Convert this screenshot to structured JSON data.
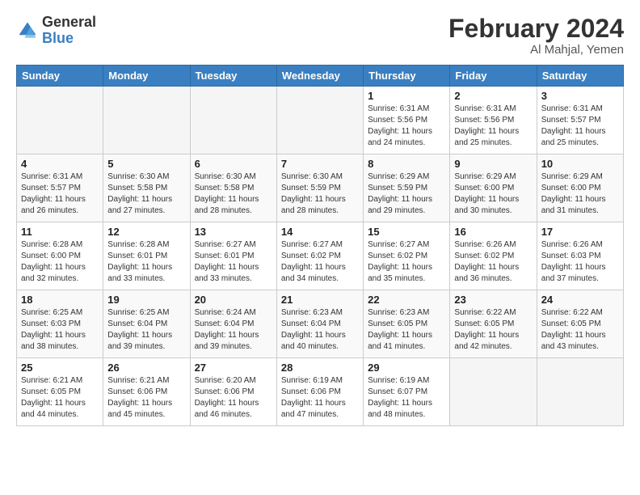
{
  "header": {
    "logo_general": "General",
    "logo_blue": "Blue",
    "month_title": "February 2024",
    "location": "Al Mahjal, Yemen"
  },
  "weekdays": [
    "Sunday",
    "Monday",
    "Tuesday",
    "Wednesday",
    "Thursday",
    "Friday",
    "Saturday"
  ],
  "weeks": [
    [
      {
        "day": "",
        "sunrise": "",
        "sunset": "",
        "daylight": ""
      },
      {
        "day": "",
        "sunrise": "",
        "sunset": "",
        "daylight": ""
      },
      {
        "day": "",
        "sunrise": "",
        "sunset": "",
        "daylight": ""
      },
      {
        "day": "",
        "sunrise": "",
        "sunset": "",
        "daylight": ""
      },
      {
        "day": "1",
        "sunrise": "Sunrise: 6:31 AM",
        "sunset": "Sunset: 5:56 PM",
        "daylight": "Daylight: 11 hours and 24 minutes."
      },
      {
        "day": "2",
        "sunrise": "Sunrise: 6:31 AM",
        "sunset": "Sunset: 5:56 PM",
        "daylight": "Daylight: 11 hours and 25 minutes."
      },
      {
        "day": "3",
        "sunrise": "Sunrise: 6:31 AM",
        "sunset": "Sunset: 5:57 PM",
        "daylight": "Daylight: 11 hours and 25 minutes."
      }
    ],
    [
      {
        "day": "4",
        "sunrise": "Sunrise: 6:31 AM",
        "sunset": "Sunset: 5:57 PM",
        "daylight": "Daylight: 11 hours and 26 minutes."
      },
      {
        "day": "5",
        "sunrise": "Sunrise: 6:30 AM",
        "sunset": "Sunset: 5:58 PM",
        "daylight": "Daylight: 11 hours and 27 minutes."
      },
      {
        "day": "6",
        "sunrise": "Sunrise: 6:30 AM",
        "sunset": "Sunset: 5:58 PM",
        "daylight": "Daylight: 11 hours and 28 minutes."
      },
      {
        "day": "7",
        "sunrise": "Sunrise: 6:30 AM",
        "sunset": "Sunset: 5:59 PM",
        "daylight": "Daylight: 11 hours and 28 minutes."
      },
      {
        "day": "8",
        "sunrise": "Sunrise: 6:29 AM",
        "sunset": "Sunset: 5:59 PM",
        "daylight": "Daylight: 11 hours and 29 minutes."
      },
      {
        "day": "9",
        "sunrise": "Sunrise: 6:29 AM",
        "sunset": "Sunset: 6:00 PM",
        "daylight": "Daylight: 11 hours and 30 minutes."
      },
      {
        "day": "10",
        "sunrise": "Sunrise: 6:29 AM",
        "sunset": "Sunset: 6:00 PM",
        "daylight": "Daylight: 11 hours and 31 minutes."
      }
    ],
    [
      {
        "day": "11",
        "sunrise": "Sunrise: 6:28 AM",
        "sunset": "Sunset: 6:00 PM",
        "daylight": "Daylight: 11 hours and 32 minutes."
      },
      {
        "day": "12",
        "sunrise": "Sunrise: 6:28 AM",
        "sunset": "Sunset: 6:01 PM",
        "daylight": "Daylight: 11 hours and 33 minutes."
      },
      {
        "day": "13",
        "sunrise": "Sunrise: 6:27 AM",
        "sunset": "Sunset: 6:01 PM",
        "daylight": "Daylight: 11 hours and 33 minutes."
      },
      {
        "day": "14",
        "sunrise": "Sunrise: 6:27 AM",
        "sunset": "Sunset: 6:02 PM",
        "daylight": "Daylight: 11 hours and 34 minutes."
      },
      {
        "day": "15",
        "sunrise": "Sunrise: 6:27 AM",
        "sunset": "Sunset: 6:02 PM",
        "daylight": "Daylight: 11 hours and 35 minutes."
      },
      {
        "day": "16",
        "sunrise": "Sunrise: 6:26 AM",
        "sunset": "Sunset: 6:02 PM",
        "daylight": "Daylight: 11 hours and 36 minutes."
      },
      {
        "day": "17",
        "sunrise": "Sunrise: 6:26 AM",
        "sunset": "Sunset: 6:03 PM",
        "daylight": "Daylight: 11 hours and 37 minutes."
      }
    ],
    [
      {
        "day": "18",
        "sunrise": "Sunrise: 6:25 AM",
        "sunset": "Sunset: 6:03 PM",
        "daylight": "Daylight: 11 hours and 38 minutes."
      },
      {
        "day": "19",
        "sunrise": "Sunrise: 6:25 AM",
        "sunset": "Sunset: 6:04 PM",
        "daylight": "Daylight: 11 hours and 39 minutes."
      },
      {
        "day": "20",
        "sunrise": "Sunrise: 6:24 AM",
        "sunset": "Sunset: 6:04 PM",
        "daylight": "Daylight: 11 hours and 39 minutes."
      },
      {
        "day": "21",
        "sunrise": "Sunrise: 6:23 AM",
        "sunset": "Sunset: 6:04 PM",
        "daylight": "Daylight: 11 hours and 40 minutes."
      },
      {
        "day": "22",
        "sunrise": "Sunrise: 6:23 AM",
        "sunset": "Sunset: 6:05 PM",
        "daylight": "Daylight: 11 hours and 41 minutes."
      },
      {
        "day": "23",
        "sunrise": "Sunrise: 6:22 AM",
        "sunset": "Sunset: 6:05 PM",
        "daylight": "Daylight: 11 hours and 42 minutes."
      },
      {
        "day": "24",
        "sunrise": "Sunrise: 6:22 AM",
        "sunset": "Sunset: 6:05 PM",
        "daylight": "Daylight: 11 hours and 43 minutes."
      }
    ],
    [
      {
        "day": "25",
        "sunrise": "Sunrise: 6:21 AM",
        "sunset": "Sunset: 6:05 PM",
        "daylight": "Daylight: 11 hours and 44 minutes."
      },
      {
        "day": "26",
        "sunrise": "Sunrise: 6:21 AM",
        "sunset": "Sunset: 6:06 PM",
        "daylight": "Daylight: 11 hours and 45 minutes."
      },
      {
        "day": "27",
        "sunrise": "Sunrise: 6:20 AM",
        "sunset": "Sunset: 6:06 PM",
        "daylight": "Daylight: 11 hours and 46 minutes."
      },
      {
        "day": "28",
        "sunrise": "Sunrise: 6:19 AM",
        "sunset": "Sunset: 6:06 PM",
        "daylight": "Daylight: 11 hours and 47 minutes."
      },
      {
        "day": "29",
        "sunrise": "Sunrise: 6:19 AM",
        "sunset": "Sunset: 6:07 PM",
        "daylight": "Daylight: 11 hours and 48 minutes."
      },
      {
        "day": "",
        "sunrise": "",
        "sunset": "",
        "daylight": ""
      },
      {
        "day": "",
        "sunrise": "",
        "sunset": "",
        "daylight": ""
      }
    ]
  ]
}
